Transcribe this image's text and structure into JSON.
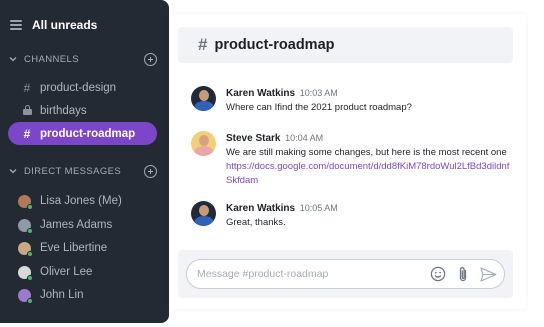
{
  "sidebar": {
    "header": "All unreads",
    "channels_label": "CHANNELS",
    "channels": [
      {
        "name": "product-design",
        "icon": "hash-icon",
        "active": false
      },
      {
        "name": "birthdays",
        "icon": "lock-icon",
        "active": false
      },
      {
        "name": "product-roadmap",
        "icon": "hash-icon",
        "active": true
      }
    ],
    "dm_label": "DIRECT MESSAGES",
    "dms": [
      {
        "name": "Lisa Jones (Me)",
        "status": "online"
      },
      {
        "name": "James Adams",
        "status": "online"
      },
      {
        "name": "Eve Libertine",
        "status": "online"
      },
      {
        "name": "Oliver Lee",
        "status": "online"
      },
      {
        "name": "John Lin",
        "status": "online"
      }
    ]
  },
  "channel": {
    "title": "product-roadmap"
  },
  "messages": [
    {
      "author": "Karen Watkins",
      "time": "10:03 AM",
      "text": "Where can Ifind the 2021 product roadmap?"
    },
    {
      "author": "Steve Stark",
      "time": "10:04 AM",
      "text": "We are still making some changes, but here is the most recent one",
      "link": "https://docs.google.com/document/d/dd8fKiM78rdoWul2LfBd3dildnfSkfdam"
    },
    {
      "author": "Karen Watkins",
      "time": "10:05 AM",
      "text": "Great, thanks."
    }
  ],
  "composer": {
    "placeholder": "Message #product-roadmap"
  },
  "colors": {
    "accent": "#7c46c8",
    "sidebar": "#232a33",
    "online": "#3fbf5f"
  }
}
